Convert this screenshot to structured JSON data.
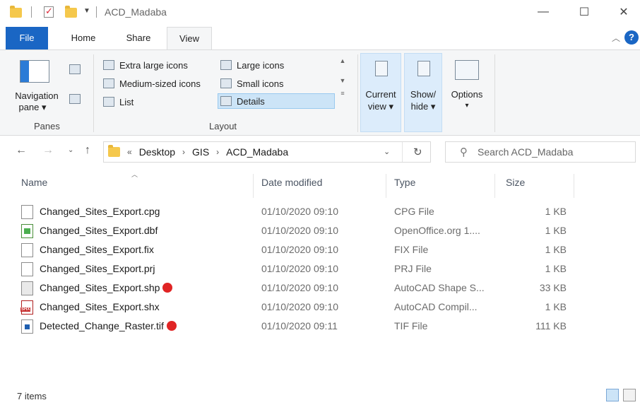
{
  "window": {
    "title": "ACD_Madaba",
    "controls": {
      "minimize": "—",
      "maximize": "☐",
      "close": "✕"
    }
  },
  "ribbon": {
    "tabs": [
      {
        "label": "File"
      },
      {
        "label": "Home"
      },
      {
        "label": "Share"
      },
      {
        "label": "View"
      }
    ],
    "panes": {
      "navigation_pane": "Navigation",
      "navigation_pane_2": "pane ▾",
      "group_label": "Panes"
    },
    "layout": {
      "items": [
        "Extra large icons",
        "Large icons",
        "Medium-sized icons",
        "Small icons",
        "List",
        "Details"
      ],
      "group_label": "Layout"
    },
    "current_view": {
      "line1": "Current",
      "line2": "view ▾"
    },
    "show_hide": {
      "line1": "Show/",
      "line2": "hide ▾"
    },
    "options": {
      "label": "Options",
      "caret": "▾"
    }
  },
  "address": {
    "overflow": "«",
    "crumbs": [
      "Desktop",
      "GIS",
      "ACD_Madaba"
    ],
    "search_placeholder": "Search ACD_Madaba"
  },
  "columns": {
    "name": "Name",
    "date": "Date modified",
    "type": "Type",
    "size": "Size"
  },
  "files": [
    {
      "name": "Changed_Sites_Export.cpg",
      "date": "01/10/2020 09:10",
      "type": "CPG File",
      "size": "1 KB",
      "icon": "file-icon",
      "marked": false
    },
    {
      "name": "Changed_Sites_Export.dbf",
      "date": "01/10/2020 09:10",
      "type": "OpenOffice.org 1....",
      "size": "1 KB",
      "icon": "dbf-icon",
      "marked": false
    },
    {
      "name": "Changed_Sites_Export.fix",
      "date": "01/10/2020 09:10",
      "type": "FIX File",
      "size": "1 KB",
      "icon": "file-icon",
      "marked": false
    },
    {
      "name": "Changed_Sites_Export.prj",
      "date": "01/10/2020 09:10",
      "type": "PRJ File",
      "size": "1 KB",
      "icon": "file-icon",
      "marked": false
    },
    {
      "name": "Changed_Sites_Export.shp",
      "date": "01/10/2020 09:10",
      "type": "AutoCAD Shape S...",
      "size": "33 KB",
      "icon": "shp-icon",
      "marked": true
    },
    {
      "name": "Changed_Sites_Export.shx",
      "date": "01/10/2020 09:10",
      "type": "AutoCAD Compil...",
      "size": "1 KB",
      "icon": "shx-icon",
      "marked": false
    },
    {
      "name": "Detected_Change_Raster.tif",
      "date": "01/10/2020 09:11",
      "type": "TIF File",
      "size": "111 KB",
      "icon": "tif-icon",
      "marked": true
    }
  ],
  "status": {
    "item_count": "7 items"
  },
  "colors": {
    "accent": "#1a66c4",
    "selection": "#cce4f7",
    "marker": "#e02424",
    "folder": "#f5c84c"
  }
}
